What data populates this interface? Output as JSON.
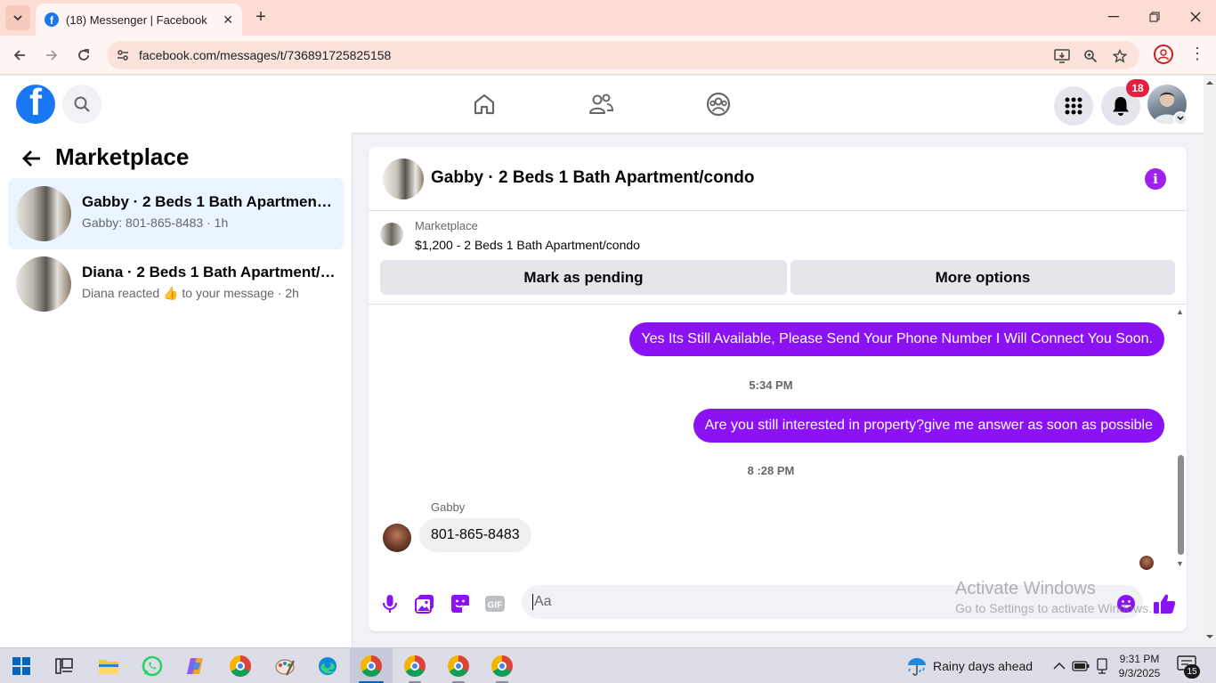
{
  "browser": {
    "tab_title": "(18) Messenger | Facebook",
    "url": "facebook.com/messages/t/736891725825158"
  },
  "facebook": {
    "notification_count": "18"
  },
  "sidebar": {
    "title": "Marketplace",
    "conversations": [
      {
        "name": "Gabby · 2 Beds 1 Bath Apartment/condo",
        "preview": "Gabby: 801-865-8483 · 1h",
        "active": true
      },
      {
        "name": "Diana · 2 Beds 1 Bath Apartment/condo",
        "preview_prefix": "Diana reacted",
        "preview_emoji": "👍",
        "preview_suffix": "to your message · 2h",
        "active": false
      }
    ]
  },
  "chat": {
    "title": "Gabby · 2 Beds 1 Bath Apartment/condo",
    "listing": {
      "label": "Marketplace",
      "title": "$1,200 - 2 Beds 1 Bath Apartment/condo",
      "mark_pending_label": "Mark as pending",
      "more_options_label": "More options"
    },
    "messages": [
      {
        "direction": "out",
        "text": "Yes Its Still Available, Please Send Your Phone Number I Will Connect You Soon."
      },
      {
        "type": "time",
        "text": "5:34 PM"
      },
      {
        "direction": "out",
        "text": "Are you still interested in property?give me answer as soon as possible"
      },
      {
        "type": "time",
        "text": "8 :28 PM"
      },
      {
        "direction": "in",
        "sender": "Gabby",
        "text": "801-865-8483"
      }
    ],
    "composer_placeholder": "Aa",
    "accent_color": "#8a12f5"
  },
  "watermark": {
    "line1": "Activate Windows",
    "line2": "Go to Settings to activate Windows."
  },
  "taskbar": {
    "weather": "Rainy days ahead",
    "time": "9:31 PM",
    "date": "9/3/2025",
    "notification_count": "15"
  }
}
